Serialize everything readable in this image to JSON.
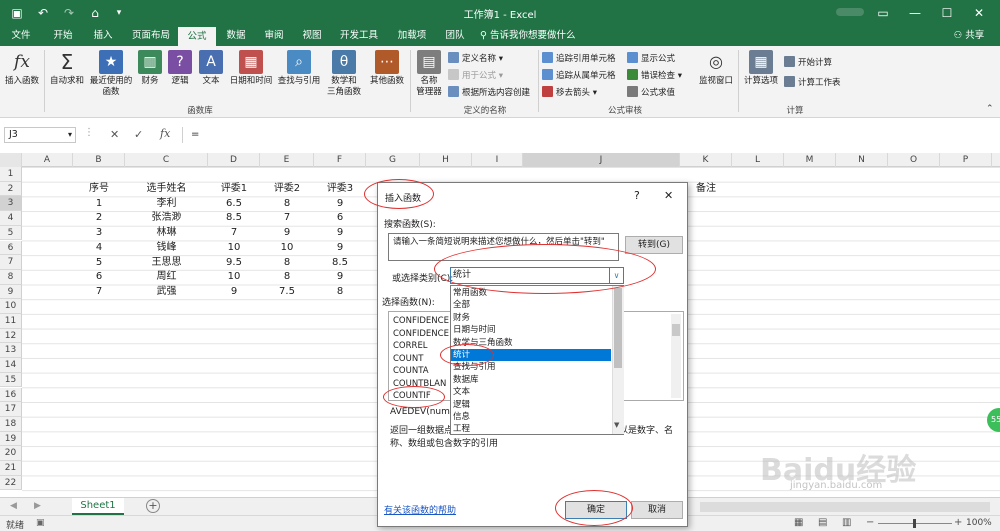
{
  "title": "工作簿1 - Excel",
  "tabs": [
    "文件",
    "开始",
    "插入",
    "页面布局",
    "公式",
    "数据",
    "审阅",
    "视图",
    "开发工具",
    "加载项",
    "团队"
  ],
  "active_tab": "公式",
  "tell_me": "告诉我你想要做什么",
  "share": "共享",
  "ribbon": {
    "insert_function": "插入函数",
    "autosum": "自动求和",
    "recent": "最近使用的\n函数",
    "finance": "财务",
    "logic": "逻辑",
    "text": "文本",
    "datetime": "日期和时间",
    "lookup": "查找与引用",
    "math": "数学和\n三角函数",
    "other": "其他函数",
    "group_lib": "函数库",
    "name_mgr": "名称\n管理器",
    "define_name": "定义名称",
    "use_in_formula": "用于公式",
    "create_from_sel": "根据所选内容创建",
    "group_names": "定义的名称",
    "trace_prec": "追踪引用单元格",
    "trace_dep": "追踪从属单元格",
    "remove_arrows": "移去箭头",
    "show_formulas": "显示公式",
    "error_check": "错误检查",
    "eval_formula": "公式求值",
    "group_audit": "公式审核",
    "watch": "监视窗口",
    "calc_options": "计算选项",
    "calc_now": "开始计算",
    "calc_sheet": "计算工作表",
    "group_calc": "计算"
  },
  "namebox": "J3",
  "formula": "=",
  "columns": [
    "A",
    "B",
    "C",
    "D",
    "E",
    "F",
    "G",
    "H",
    "I",
    "J",
    "K",
    "L",
    "M",
    "N",
    "O",
    "P"
  ],
  "rows": [
    "1",
    "2",
    "3",
    "4",
    "5",
    "6",
    "7",
    "8",
    "9",
    "10",
    "11",
    "12",
    "13",
    "14",
    "15",
    "16",
    "17",
    "18",
    "19",
    "20",
    "21",
    "22"
  ],
  "table": {
    "headers": [
      "序号",
      "选手姓名",
      "评委1",
      "评委2",
      "评委3"
    ],
    "data": [
      [
        "1",
        "李利",
        "6.5",
        "8",
        "9"
      ],
      [
        "2",
        "张浩渺",
        "8.5",
        "7",
        "6"
      ],
      [
        "3",
        "林琳",
        "7",
        "9",
        "9"
      ],
      [
        "4",
        "钱峰",
        "10",
        "10",
        "9"
      ],
      [
        "5",
        "王思思",
        "9.5",
        "8",
        "8.5"
      ],
      [
        "6",
        "周红",
        "10",
        "8",
        "9"
      ],
      [
        "7",
        "武强",
        "9",
        "7.5",
        "8"
      ]
    ],
    "remark": "备注"
  },
  "sheet_tab": "Sheet1",
  "status": "就绪",
  "zoom": "100%",
  "dialog": {
    "title": "插入函数",
    "help": "?",
    "close": "✕",
    "search_label": "搜索函数(S):",
    "search_text": "请输入一条简短说明来描述您想做什么，然后单击\"转到\"",
    "go": "转到(G)",
    "category_label": "或选择类别(C):",
    "category_value": "统计",
    "select_label": "选择函数(N):",
    "categories": [
      "常用函数",
      "全部",
      "财务",
      "日期与时间",
      "数学与三角函数",
      "统计",
      "查找与引用",
      "数据库",
      "文本",
      "逻辑",
      "信息",
      "工程"
    ],
    "selected_category": "统计",
    "functions": [
      "CONFIDENCE",
      "CONFIDENCE",
      "CORREL",
      "COUNT",
      "COUNTA",
      "COUNTBLAN",
      "COUNTIF"
    ],
    "signature": "AVEDEV(numb",
    "desc1": "返回一组数据点",
    "desc2": "称、数组或包含数字的引用",
    "desc_tail": "可以是数字、名",
    "help_link": "有关该函数的帮助",
    "ok": "确定",
    "cancel": "取消"
  },
  "watermark": "Baidu经验",
  "watermark_sub": "jingyan.baidu.com",
  "badge": "55"
}
